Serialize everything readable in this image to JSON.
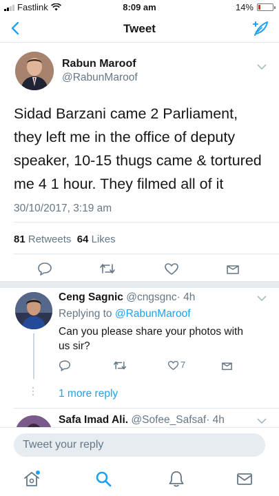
{
  "status_bar": {
    "carrier": "Fastlink",
    "time": "8:09 am",
    "battery": "14%",
    "battery_level": 0.14
  },
  "nav": {
    "title": "Tweet"
  },
  "tweet": {
    "author_name": "Rabun Maroof",
    "author_handle": "@RabunMaroof",
    "text": "Sidad Barzani came 2 Parliament, they left me in the office of deputy speaker, 10-15 thugs came & tortured me 4 1 hour. They filmed all of it",
    "timestamp": "30/10/2017, 3:19 am",
    "retweets_count": "81",
    "retweets_label": "Retweets",
    "likes_count": "64",
    "likes_label": "Likes"
  },
  "replies": [
    {
      "name": "Ceng Sagnic",
      "handle": "@cngsgnc",
      "time": "· 4h",
      "replying_prefix": "Replying to",
      "replying_to": "@RabunMaroof",
      "text": "Can you please share your photos with us sir?",
      "like_count": "7",
      "more_replies": "1 more reply"
    },
    {
      "name": "Safa Imad Ali.",
      "handle": "@Sofee_Safsaf",
      "time": "· 4h"
    }
  ],
  "compose": {
    "placeholder": "Tweet your reply"
  },
  "colors": {
    "accent": "#1da1f2",
    "secondary_text": "#657786",
    "divider": "#e1e8ed",
    "battery_low": "#e0211e"
  },
  "icons": {
    "back": "chevron-left-icon",
    "compose": "feather-compose-icon",
    "reply": "reply-icon",
    "retweet": "retweet-icon",
    "like": "heart-icon",
    "share": "share-icon",
    "home": "home-icon",
    "search": "search-icon",
    "notifications": "bell-icon",
    "messages": "envelope-icon"
  }
}
